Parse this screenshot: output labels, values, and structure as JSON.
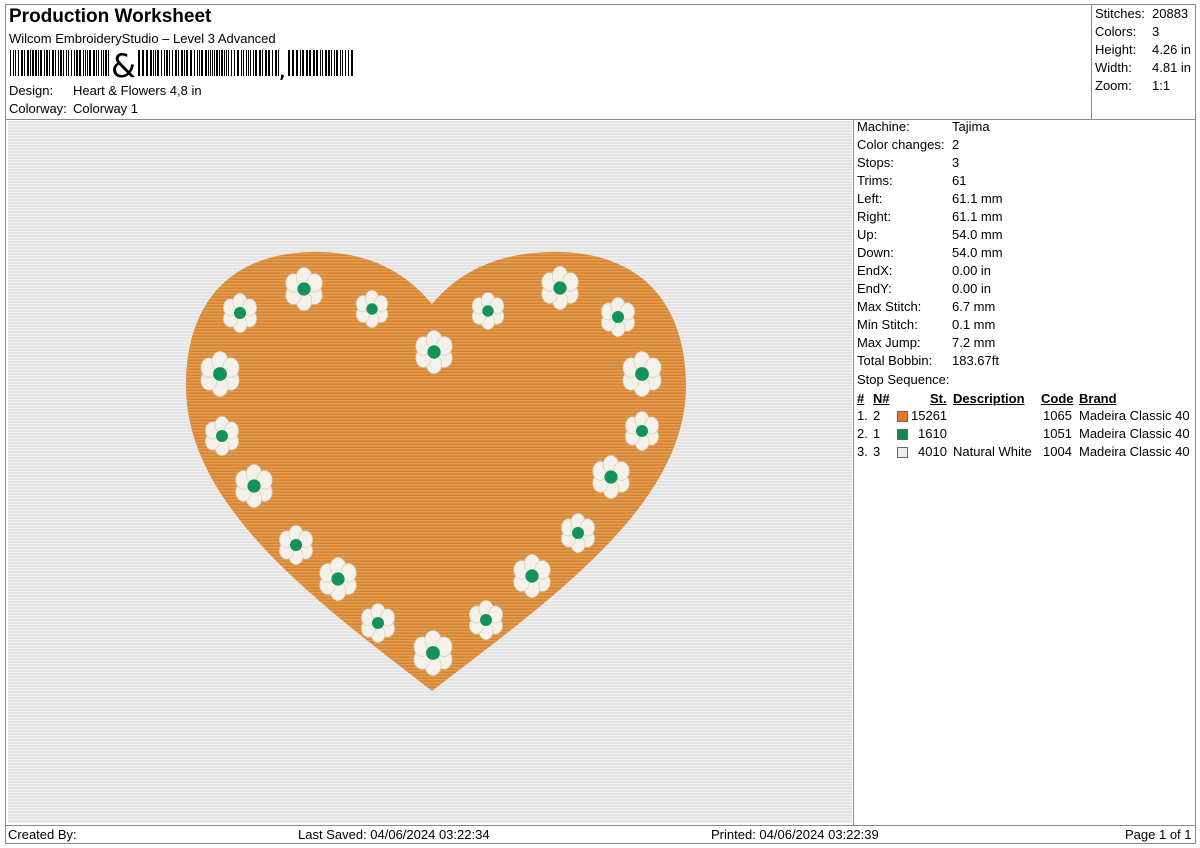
{
  "header": {
    "title": "Production Worksheet",
    "software": "Wilcom EmbroideryStudio – Level 3 Advanced",
    "design_label": "Design:",
    "design_value": "Heart & Flowers 4,8 in",
    "colorway_label": "Colorway:",
    "colorway_value": "Colorway 1"
  },
  "summary": [
    {
      "label": "Stitches:",
      "value": "20883"
    },
    {
      "label": "Colors:",
      "value": "3"
    },
    {
      "label": "Height:",
      "value": "4.26 in"
    },
    {
      "label": "Width:",
      "value": "4.81 in"
    },
    {
      "label": "Zoom:",
      "value": "1:1"
    }
  ],
  "details": [
    {
      "label": "Machine:",
      "value": "Tajima"
    },
    {
      "label": "Color changes:",
      "value": "2"
    },
    {
      "label": "Stops:",
      "value": "3"
    },
    {
      "label": "Trims:",
      "value": "61"
    },
    {
      "label": "Left:",
      "value": "61.1 mm"
    },
    {
      "label": "Right:",
      "value": "61.1 mm"
    },
    {
      "label": "Up:",
      "value": "54.0 mm"
    },
    {
      "label": "Down:",
      "value": "54.0 mm"
    },
    {
      "label": "EndX:",
      "value": "0.00 in"
    },
    {
      "label": "EndY:",
      "value": "0.00 in"
    },
    {
      "label": "Max Stitch:",
      "value": "6.7 mm"
    },
    {
      "label": "Min Stitch:",
      "value": "0.1 mm"
    },
    {
      "label": "Max Jump:",
      "value": "7.2 mm"
    },
    {
      "label": "Total Bobbin:",
      "value": "183.67ft"
    }
  ],
  "stop_sequence": {
    "title": "Stop Sequence:",
    "headers": {
      "num": "#",
      "n": "N#",
      "st": "St.",
      "description": "Description",
      "code": "Code",
      "brand": "Brand"
    },
    "rows": [
      {
        "num": "1.",
        "n": "2",
        "color": "#e6782a",
        "st": "15261",
        "description": "",
        "code": "1065",
        "brand": "Madeira Classic 40"
      },
      {
        "num": "2.",
        "n": "1",
        "color": "#12874a",
        "st": "1610",
        "description": "",
        "code": "1051",
        "brand": "Madeira Classic 40"
      },
      {
        "num": "3.",
        "n": "3",
        "color": "#eeeeee",
        "st": "4010",
        "description": "Natural White",
        "code": "1004",
        "brand": "Madeira Classic 40"
      }
    ]
  },
  "footer": {
    "created_by": "Created By:",
    "last_saved": "Last Saved: 04/06/2024 03:22:34",
    "printed": "Printed: 04/06/2024 03:22:39",
    "page": "Page 1 of 1"
  },
  "design": {
    "fill_color": "#df8f3c",
    "petal_color": "#f3f1ea",
    "center_color": "#13925a"
  }
}
